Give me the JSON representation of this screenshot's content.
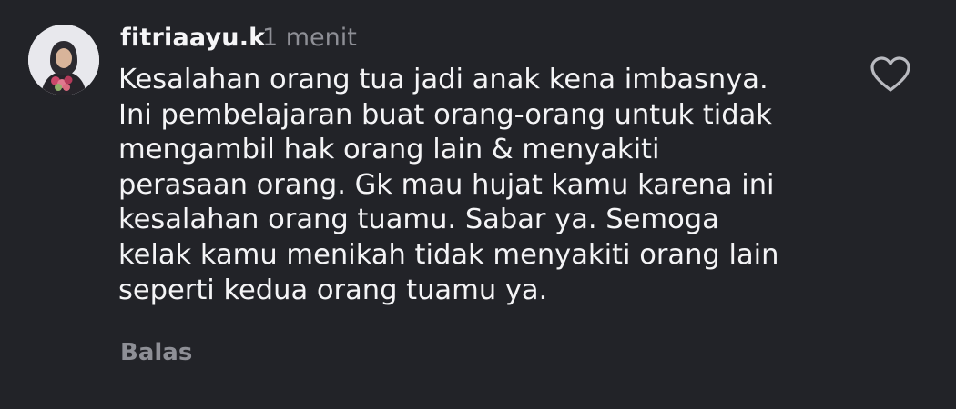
{
  "comment": {
    "username": "fitriaayu.k",
    "time": "1 menit",
    "lines": [
      "Kesalahan orang tua jadi anak kena imbasnya.",
      "Ini pembelajaran buat orang-orang untuk tidak",
      "mengambil hak orang lain & menyakiti",
      "perasaan orang. Gk mau hujat kamu karena ini",
      "kesalahan orang tuamu. Sabar ya. Semoga",
      "kelak kamu menikah tidak menyakiti orang lain",
      "seperti kedua orang tuamu ya."
    ],
    "reply_label": "Balas",
    "avatar_icon": "user-avatar",
    "like_icon": "heart-outline-icon"
  },
  "colors": {
    "background": "#222328",
    "text": "#f4f4f6",
    "muted": "#8e8f96"
  }
}
